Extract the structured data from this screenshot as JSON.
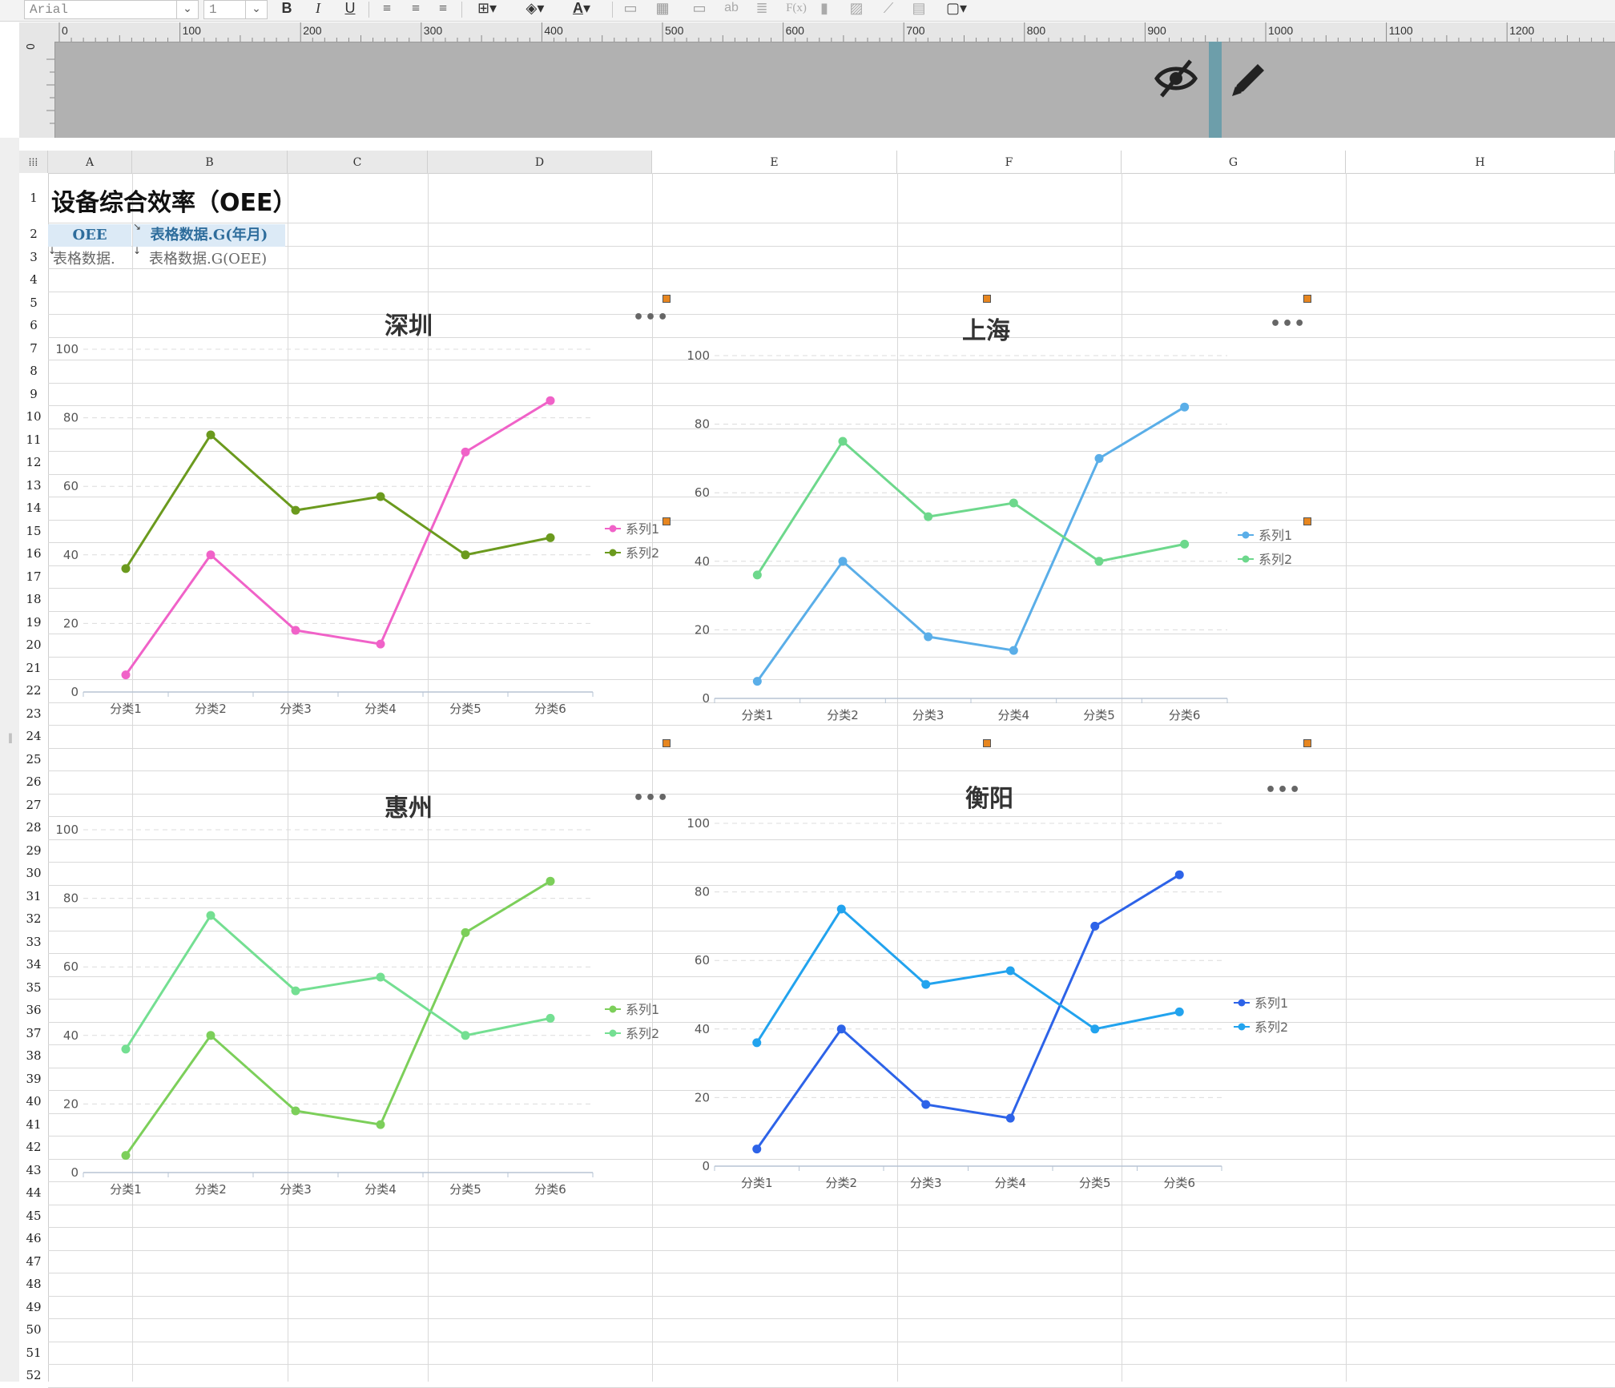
{
  "toolbar": {
    "font_name": "Arial",
    "font_size": "1",
    "bold_label": "B",
    "italic_label": "I",
    "underline_label": "U",
    "font_color_label": "A",
    "text_ab": "ab",
    "formula_label": "F(x)"
  },
  "ruler": {
    "labels": [
      "0",
      "100",
      "200",
      "300",
      "400",
      "500",
      "600",
      "700",
      "800",
      "900",
      "1000",
      "1100",
      "1200"
    ],
    "vertical_label": "0"
  },
  "columns": [
    "A",
    "B",
    "C",
    "D",
    "E",
    "F",
    "G",
    "H"
  ],
  "rows": [
    "1",
    "2",
    "3",
    "4",
    "5",
    "6",
    "7",
    "8",
    "9",
    "10",
    "11",
    "12",
    "13",
    "14",
    "15",
    "16",
    "17",
    "18",
    "19",
    "20",
    "21",
    "22",
    "23",
    "24",
    "25",
    "26",
    "27",
    "28",
    "29",
    "30",
    "31",
    "32",
    "33",
    "34",
    "35",
    "36",
    "37",
    "38",
    "39",
    "40",
    "41",
    "42",
    "43",
    "44",
    "45",
    "46",
    "47",
    "48",
    "49",
    "50",
    "51",
    "52"
  ],
  "cells": {
    "title": "设备综合效率（OEE）",
    "a2": "OEE",
    "b2": "表格数据.G(年月)",
    "a3": "表格数据.",
    "b3": "表格数据.G(OEE)"
  },
  "chart_data": [
    {
      "type": "line",
      "title": "深圳",
      "categories": [
        "分类1",
        "分类2",
        "分类3",
        "分类4",
        "分类5",
        "分类6"
      ],
      "yticks": [
        "0",
        "20",
        "40",
        "60",
        "80",
        "100"
      ],
      "ylim": [
        0,
        100
      ],
      "legend_position": "right",
      "series": [
        {
          "name": "系列1",
          "color": "#f062c8",
          "values": [
            5,
            40,
            18,
            14,
            70,
            85
          ]
        },
        {
          "name": "系列2",
          "color": "#6b9a1e",
          "values": [
            36,
            75,
            53,
            57,
            40,
            45
          ]
        }
      ]
    },
    {
      "type": "line",
      "title": "上海",
      "categories": [
        "分类1",
        "分类2",
        "分类3",
        "分类4",
        "分类5",
        "分类6"
      ],
      "yticks": [
        "0",
        "20",
        "40",
        "60",
        "80",
        "100"
      ],
      "ylim": [
        0,
        100
      ],
      "legend_position": "right",
      "series": [
        {
          "name": "系列1",
          "color": "#5aaee8",
          "values": [
            5,
            40,
            18,
            14,
            70,
            85
          ]
        },
        {
          "name": "系列2",
          "color": "#6dd88c",
          "values": [
            36,
            75,
            53,
            57,
            40,
            45
          ]
        }
      ]
    },
    {
      "type": "line",
      "title": "惠州",
      "categories": [
        "分类1",
        "分类2",
        "分类3",
        "分类4",
        "分类5",
        "分类6"
      ],
      "yticks": [
        "0",
        "20",
        "40",
        "60",
        "80",
        "100"
      ],
      "ylim": [
        0,
        100
      ],
      "legend_position": "right",
      "series": [
        {
          "name": "系列1",
          "color": "#7ccf5a",
          "values": [
            5,
            40,
            18,
            14,
            70,
            85
          ]
        },
        {
          "name": "系列2",
          "color": "#74df92",
          "values": [
            36,
            75,
            53,
            57,
            40,
            45
          ]
        }
      ]
    },
    {
      "type": "line",
      "title": "衡阳",
      "categories": [
        "分类1",
        "分类2",
        "分类3",
        "分类4",
        "分类5",
        "分类6"
      ],
      "yticks": [
        "0",
        "20",
        "40",
        "60",
        "80",
        "100"
      ],
      "ylim": [
        0,
        100
      ],
      "legend_position": "right",
      "series": [
        {
          "name": "系列1",
          "color": "#2d63e8",
          "values": [
            5,
            40,
            18,
            14,
            70,
            85
          ]
        },
        {
          "name": "系列2",
          "color": "#22a3ee",
          "values": [
            36,
            75,
            53,
            57,
            40,
            45
          ]
        }
      ]
    }
  ]
}
